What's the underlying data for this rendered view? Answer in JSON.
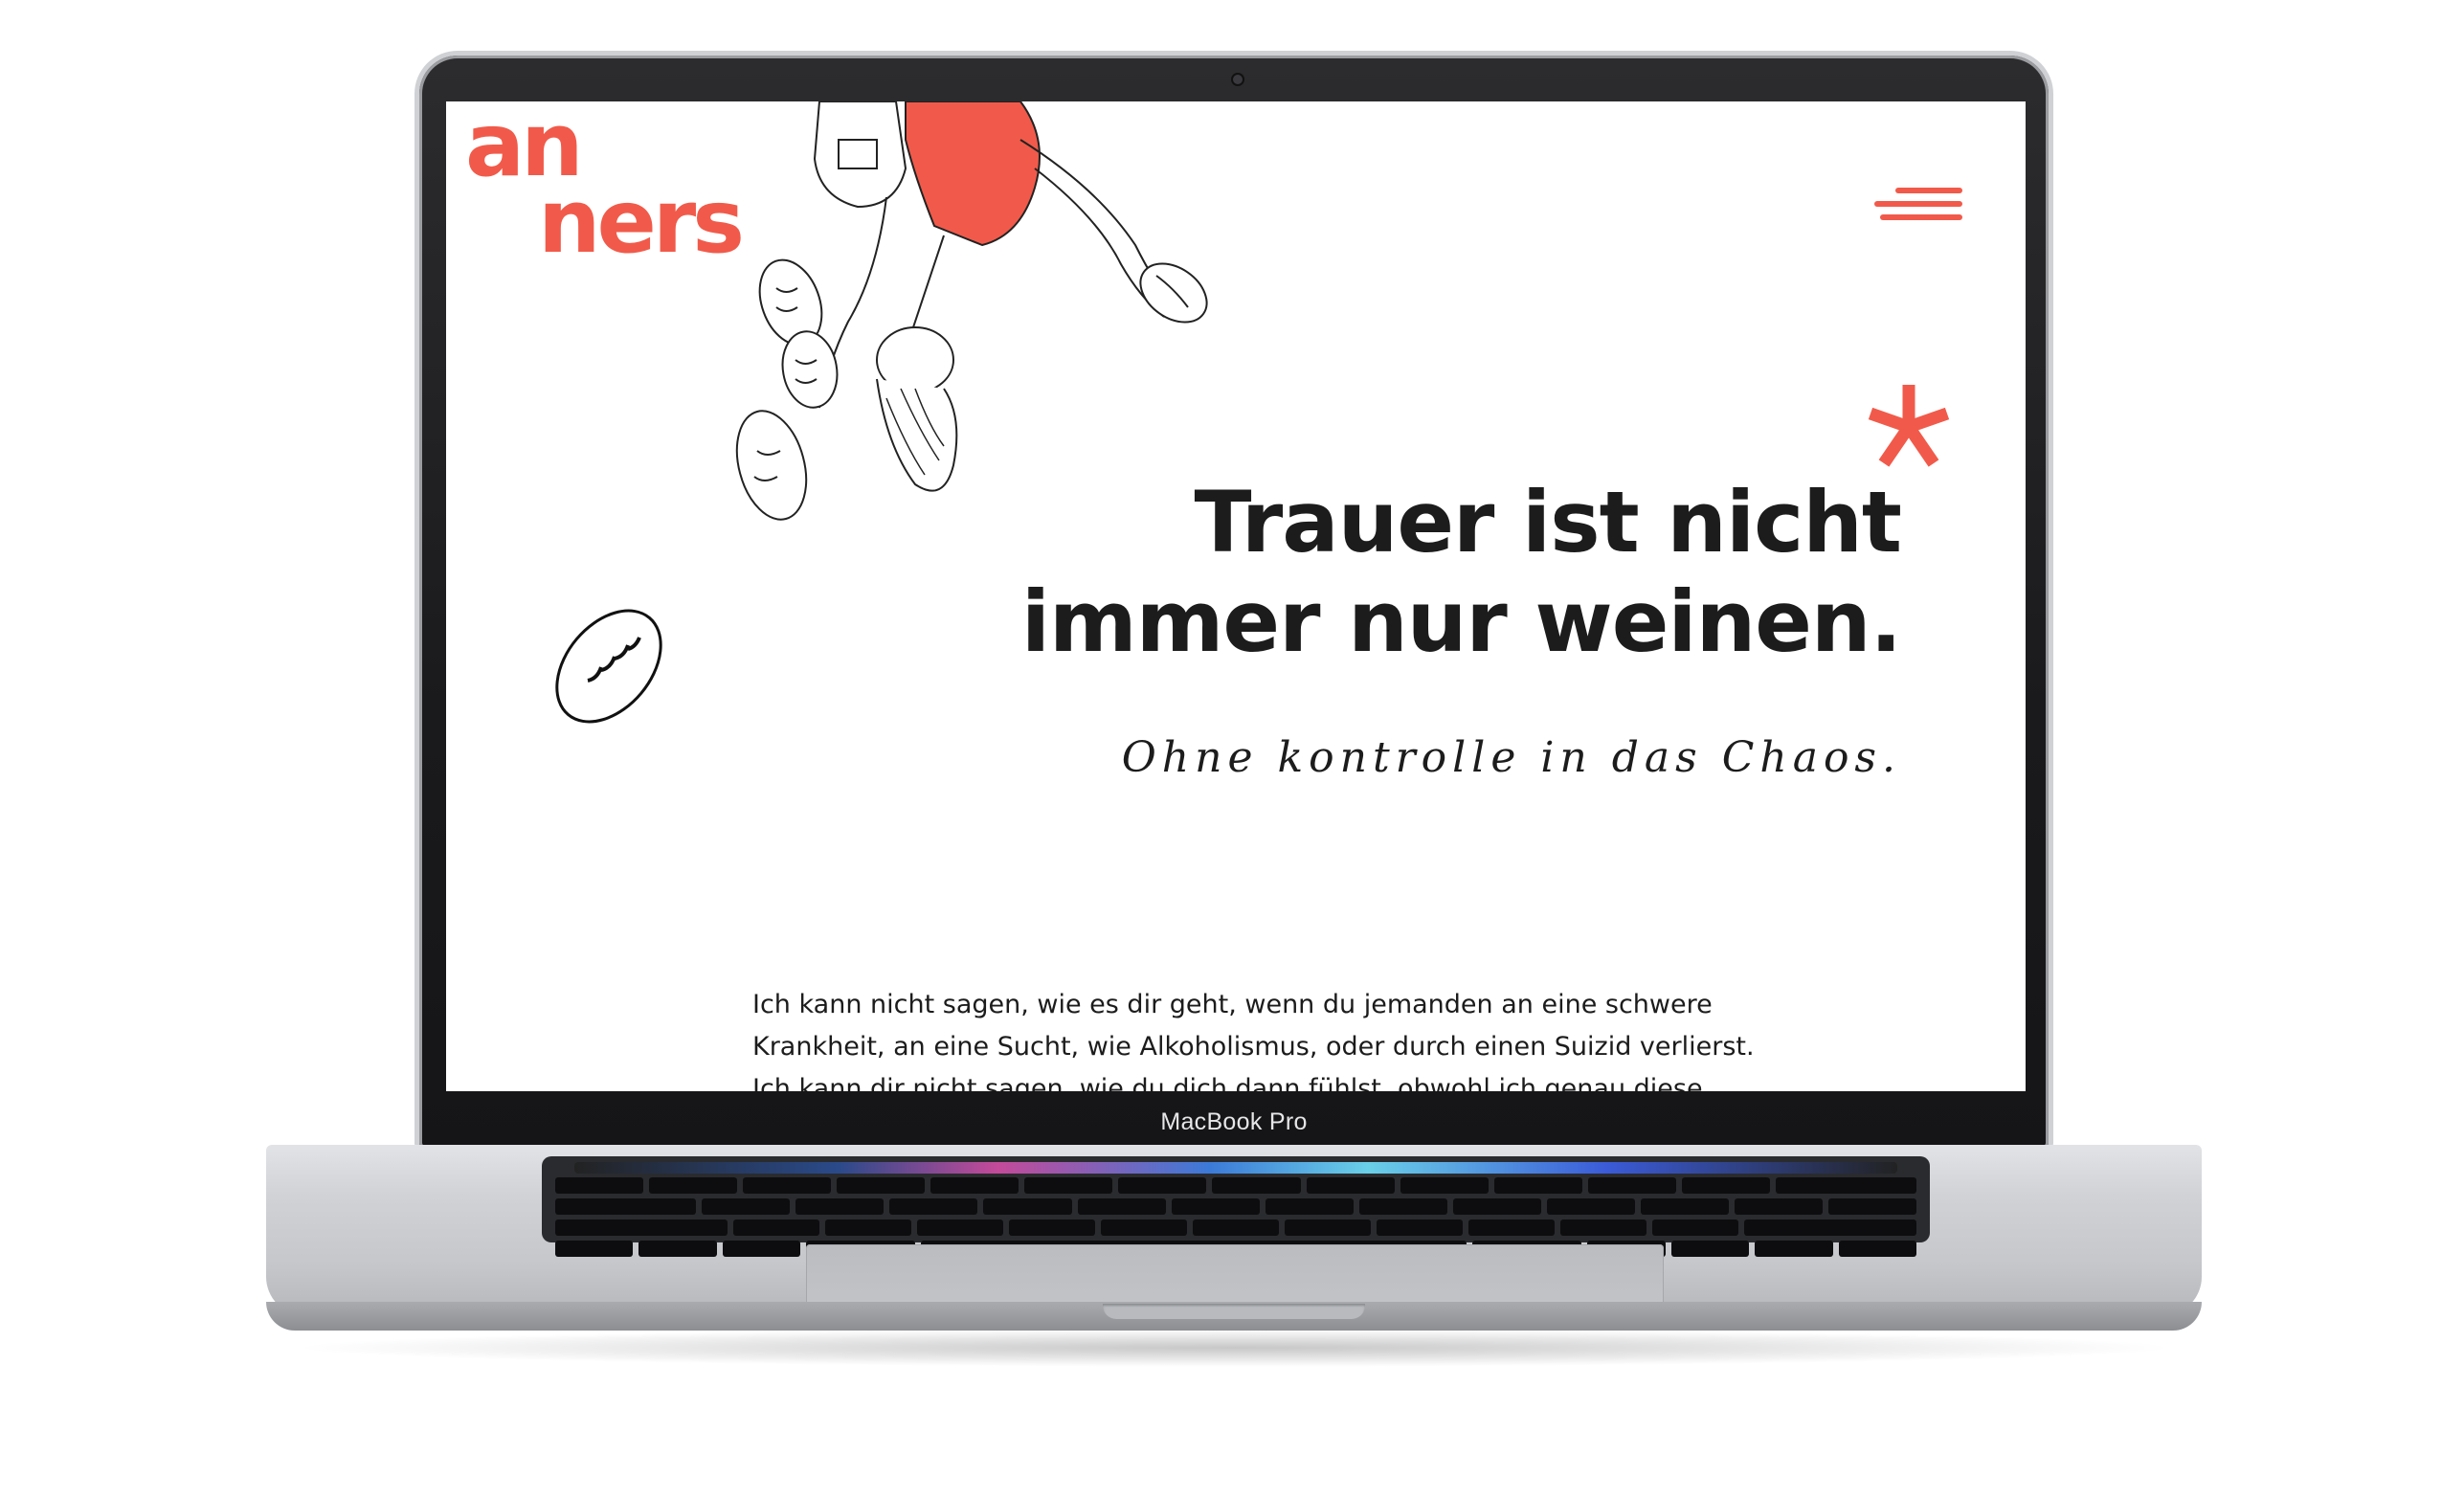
{
  "device": {
    "label": "MacBook Pro"
  },
  "site": {
    "logo": {
      "line1": "an",
      "line2": "ners"
    },
    "menu_icon": "hamburger-menu-icon",
    "accent_color": "#f15a4a",
    "hero": {
      "headline_line1": "Trauer ist nicht",
      "headline_line2": "immer nur weinen.",
      "handwritten": "Ohne kontrolle in das Chaos."
    },
    "body": {
      "line1": "Ich kann nicht sagen, wie es dir geht, wenn du jemanden an eine schwere",
      "line2": "Krankheit, an eine Sucht, wie Alkoholismus, oder durch einen Suizid verlierst.",
      "line3": "Ich kann dir nicht sagen, wie du dich dann fühlst, obwohl ich genau diese"
    }
  }
}
